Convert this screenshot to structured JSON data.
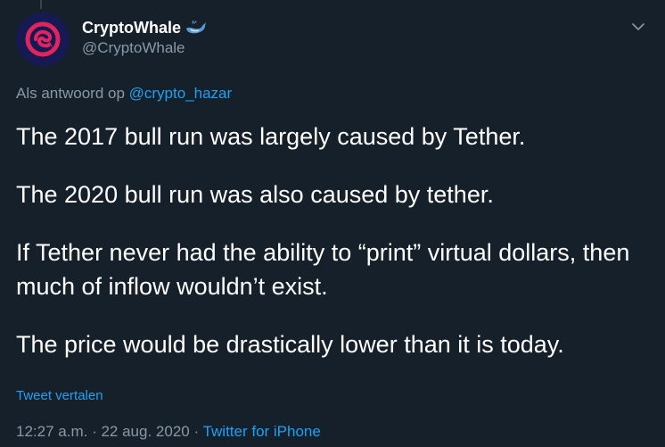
{
  "author": {
    "display_name": "CryptoWhale",
    "handle": "@CryptoWhale",
    "badge_icon": "whale-icon"
  },
  "reply": {
    "prefix": "Als antwoord op ",
    "mention": "@crypto_hazar"
  },
  "tweet": {
    "paragraphs": [
      "The 2017 bull run was largely caused by Tether.",
      "The 2020 bull run was also caused by tether.",
      "If Tether never had the ability to “print” virtual dollars, then much of inflow wouldn’t exist.",
      "The price would be drastically lower than it is today."
    ],
    "translate_label": "Tweet vertalen"
  },
  "meta": {
    "time": "12:27 a.m.",
    "separator": "·",
    "date": "22 aug. 2020",
    "source": "Twitter for iPhone"
  },
  "colors": {
    "background": "#15202b",
    "accent": "#1da1f2",
    "secondary_text": "#8899a6",
    "avatar_bg": "#171a52",
    "avatar_logo": "#e0245e"
  },
  "icons": {
    "menu": "chevron-down-icon",
    "avatar_logo": "cryptowhale-logo-icon"
  }
}
